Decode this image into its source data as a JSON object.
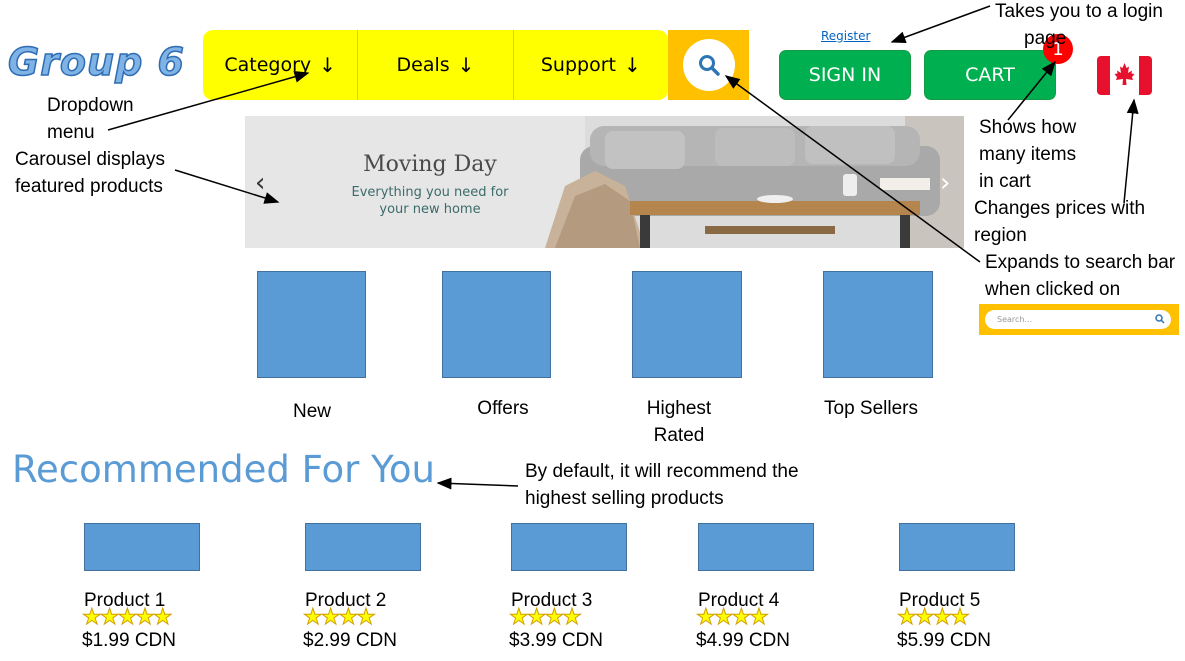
{
  "logo": {
    "text": "Group 6"
  },
  "nav": {
    "items": [
      {
        "label": "Category",
        "arrow": "↓"
      },
      {
        "label": "Deals",
        "arrow": "↓"
      },
      {
        "label": "Support",
        "arrow": "↓"
      }
    ],
    "search_icon": "search-icon"
  },
  "header": {
    "register": "Register",
    "sign_in": "SIGN IN",
    "cart": "CART",
    "cart_count": "1",
    "flag": "canada-flag"
  },
  "carousel": {
    "title": "Moving Day",
    "subtitle_line1": "Everything you need for",
    "subtitle_line2": "your new home",
    "prev": "‹",
    "next": "›"
  },
  "categories": [
    "New",
    "Offers",
    "Highest Rated",
    "Top Sellers"
  ],
  "recommended": {
    "title": "Recommended For You",
    "products": [
      {
        "name": "Product 1",
        "stars": "★★★★★",
        "rating": 5,
        "price": "$1.99 CDN"
      },
      {
        "name": "Product 2",
        "stars": "★★★★",
        "rating": 4,
        "price": "$2.99 CDN"
      },
      {
        "name": "Product 3",
        "stars": "★★★★",
        "rating": 4,
        "price": "$3.99 CDN"
      },
      {
        "name": "Product 4",
        "stars": "★★★★",
        "rating": 4,
        "price": "$4.99 CDN"
      },
      {
        "name": "Product 5",
        "stars": "★★★★",
        "rating": 4,
        "price": "$5.99 CDN"
      }
    ]
  },
  "annotations": {
    "login": [
      "Takes you to a login",
      "page"
    ],
    "dropdown": [
      "Dropdown",
      "menu"
    ],
    "carousel": [
      "Carousel displays",
      "featured products"
    ],
    "cart_count": [
      "Shows how",
      "many items",
      "in cart"
    ],
    "region": [
      "Changes prices with",
      "region"
    ],
    "search": [
      "Expands to search bar",
      "when clicked on"
    ],
    "recommend": [
      "By default, it will recommend the",
      "highest selling products"
    ]
  },
  "mini_search": {
    "placeholder": "Search..."
  },
  "colors": {
    "nav_yellow": "#ffff00",
    "search_gold": "#ffc000",
    "button_green": "#00b050",
    "tile_blue": "#5b9bd5",
    "badge_red": "#ff0000",
    "link_blue": "#0563c1"
  }
}
